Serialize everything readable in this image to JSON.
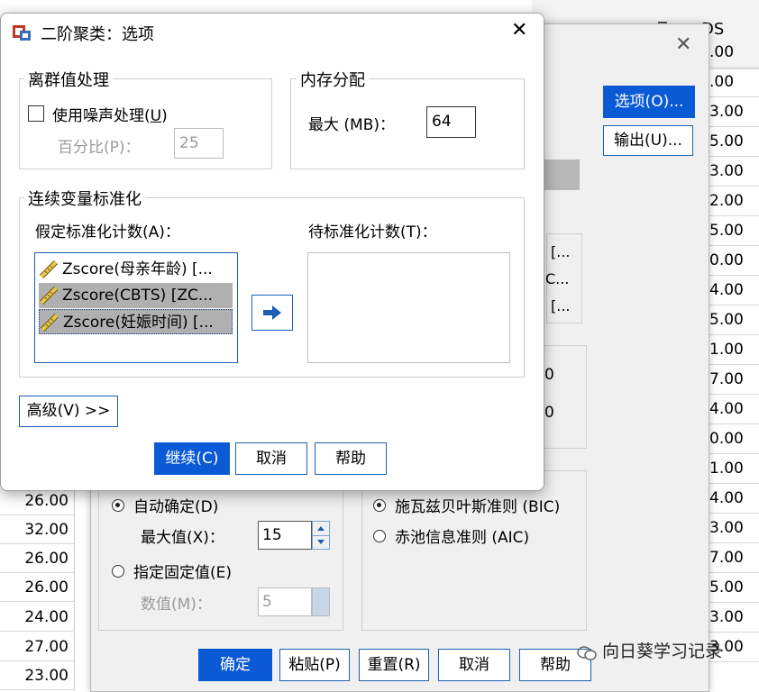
{
  "background": {
    "left_values": [
      "26.00",
      "32.00",
      "26.00",
      "26.00",
      "24.00",
      "27.00",
      "23.00"
    ],
    "right_values": [
      ".00",
      ".00",
      "3.00",
      "5.00",
      "3.00",
      "2.00",
      "5.00",
      "0.00",
      "4.00",
      "5.00",
      "1.00",
      "7.00",
      "4.00",
      "0.00",
      "1.00",
      "4.00",
      "3.00",
      "7.00",
      "5.00",
      "3.00",
      "3.00"
    ],
    "header_fragment": "DS",
    "main_dialog": {
      "side_buttons": {
        "options": "选项(O)...",
        "output": "输出(U)..."
      },
      "partial_texts": [
        "[...",
        "C...",
        "[...",
        "0",
        "0"
      ],
      "clusters_group": {
        "auto_label": "自动确定(D)",
        "max_label": "最大值(X)：",
        "max_value": "15",
        "fixed_label": "指定固定值(E)",
        "count_label": "数值(M)：",
        "count_value": "5"
      },
      "criterion_group": {
        "bic_label": "施瓦兹贝叶斯准则 (BIC)",
        "aic_label": "赤池信息准则 (AIC)"
      },
      "bottom_buttons": {
        "ok": "确定",
        "paste": "粘贴(P)",
        "reset": "重置(R)",
        "cancel": "取消",
        "help": "帮助"
      },
      "watermark": "向日葵学习记录"
    }
  },
  "dialog": {
    "title": "二阶聚类：选项",
    "outlier": {
      "legend": "离群值处理",
      "noise_label_pre": "使用噪声处理(",
      "noise_key": "U",
      "noise_label_post": ")",
      "noise_checked": false,
      "percent_label": "百分比(P)：",
      "percent_value": "25"
    },
    "memory": {
      "legend": "内存分配",
      "max_label": "最大 (MB)：",
      "max_value": "64"
    },
    "standardize": {
      "legend": "连续变量标准化",
      "assumed_label": "假定标准化计数(A)：",
      "to_label": "待标准化计数(T)：",
      "assumed_items": [
        "Zscore(母亲年龄) [...",
        "Zscore(CBTS) [ZC...",
        "Zscore(妊娠时间) [..."
      ]
    },
    "advanced_button": "高级(V) >>",
    "buttons": {
      "continue": "继续(C)",
      "cancel": "取消",
      "help": "帮助"
    },
    "colors": {
      "accent": "#0a5ad6",
      "border": "#1a5fb4"
    }
  }
}
